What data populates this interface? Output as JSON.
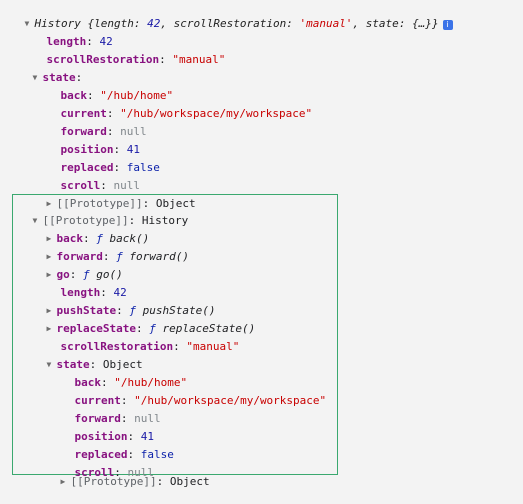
{
  "summary": {
    "head": "History",
    "brace_open": " {",
    "length_key": "length",
    "length_val": "42",
    "comma1": ", ",
    "scroll_key": "scrollRestoration",
    "scroll_val": "'manual'",
    "comma2": ", ",
    "state_key": "state",
    "state_val": "{…}",
    "brace_close": "}",
    "info": "i"
  },
  "top": {
    "length_key": "length",
    "length_val": "42",
    "scroll_key": "scrollRestoration",
    "scroll_val": "\"manual\"",
    "state_key": "state",
    "state": {
      "back_key": "back",
      "back_val": "\"/hub/home\"",
      "current_key": "current",
      "current_val": "\"/hub/workspace/my/workspace\"",
      "forward_key": "forward",
      "forward_val": "null",
      "position_key": "position",
      "position_val": "41",
      "replaced_key": "replaced",
      "replaced_val": "false",
      "scroll_key": "scroll",
      "scroll_val": "null",
      "proto_key": "[[Prototype]]",
      "proto_val": "Object"
    }
  },
  "prototype": {
    "key": "[[Prototype]]",
    "val": "History",
    "back_key": "back",
    "back_f": "ƒ",
    "back_fn": "back()",
    "forward_key": "forward",
    "forward_f": "ƒ",
    "forward_fn": "forward()",
    "go_key": "go",
    "go_f": "ƒ",
    "go_fn": "go()",
    "length_key": "length",
    "length_val": "42",
    "pushstate_key": "pushState",
    "pushstate_f": "ƒ",
    "pushstate_fn": "pushState()",
    "replacestate_key": "replaceState",
    "replacestate_f": "ƒ",
    "replacestate_fn": "replaceState()",
    "scroll_key": "scrollRestoration",
    "scroll_val": "\"manual\"",
    "state_key": "state",
    "state_val": "Object",
    "state": {
      "back_key": "back",
      "back_val": "\"/hub/home\"",
      "current_key": "current",
      "current_val": "\"/hub/workspace/my/workspace\"",
      "forward_key": "forward",
      "forward_val": "null",
      "position_key": "position",
      "position_val": "41",
      "replaced_key": "replaced",
      "replaced_val": "false",
      "scroll_key": "scroll",
      "scroll_val": "null",
      "proto_key": "[[Prototype]]",
      "proto_val": "Object"
    }
  },
  "colors": {
    "key": "#881280",
    "string": "#c80000",
    "number": "#1a1aa6",
    "null": "#80868b",
    "highlight_border": "#3aa86f",
    "info_badge": "#3b73e8"
  }
}
